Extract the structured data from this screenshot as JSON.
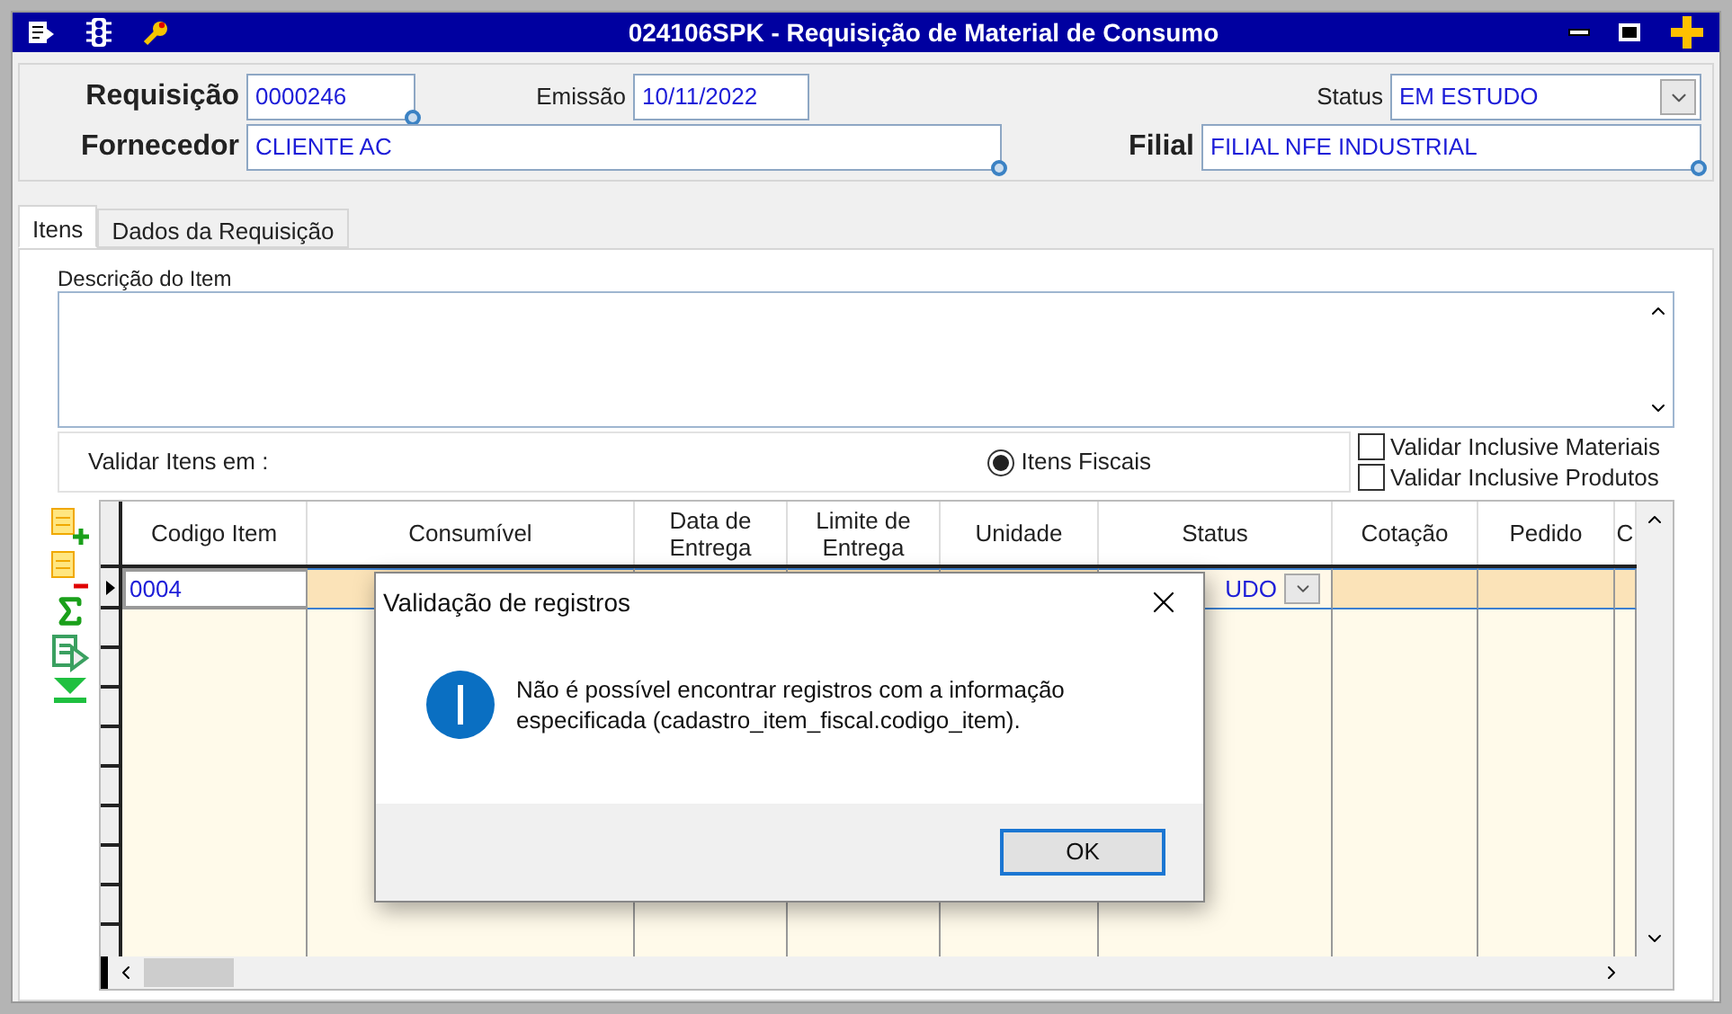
{
  "window": {
    "title": "024106SPK - Requisição de Material de Consumo"
  },
  "header": {
    "requisicao": {
      "label": "Requisição",
      "value": "0000246"
    },
    "emissao": {
      "label": "Emissão",
      "value": "10/11/2022"
    },
    "status": {
      "label": "Status",
      "value": "EM ESTUDO"
    },
    "fornecedor": {
      "label": "Fornecedor",
      "value": "CLIENTE AC"
    },
    "filial": {
      "label": "Filial",
      "value": "FILIAL NFE INDUSTRIAL"
    }
  },
  "tabs": [
    {
      "label": "Itens",
      "selected": true
    },
    {
      "label": "Dados da Requisição",
      "selected": false
    }
  ],
  "description": {
    "label": "Descrição do Item"
  },
  "validation": {
    "label": "Validar Itens em :",
    "radios": [
      {
        "label": "Itens Fiscais",
        "selected": true
      }
    ],
    "checkboxes": [
      {
        "label": "Validar Inclusive Materiais",
        "checked": false
      },
      {
        "label": "Validar Inclusive Produtos",
        "checked": false
      }
    ]
  },
  "table": {
    "columns": [
      "Codigo Item",
      "Consumível",
      "Data de Entrega",
      "Limite de Entrega",
      "Unidade",
      "Status",
      "Cotação",
      "Pedido",
      "C"
    ],
    "rows": [
      {
        "selected": true,
        "cells": [
          "0004",
          "",
          "",
          "",
          "",
          "UDO",
          "",
          "",
          ""
        ]
      }
    ]
  },
  "dialog": {
    "title": "Validação de registros",
    "message": "Não é possível encontrar registros com a informação especificada (cadastro_item_fiscal.codigo_item).",
    "buttons": [
      "OK"
    ]
  }
}
